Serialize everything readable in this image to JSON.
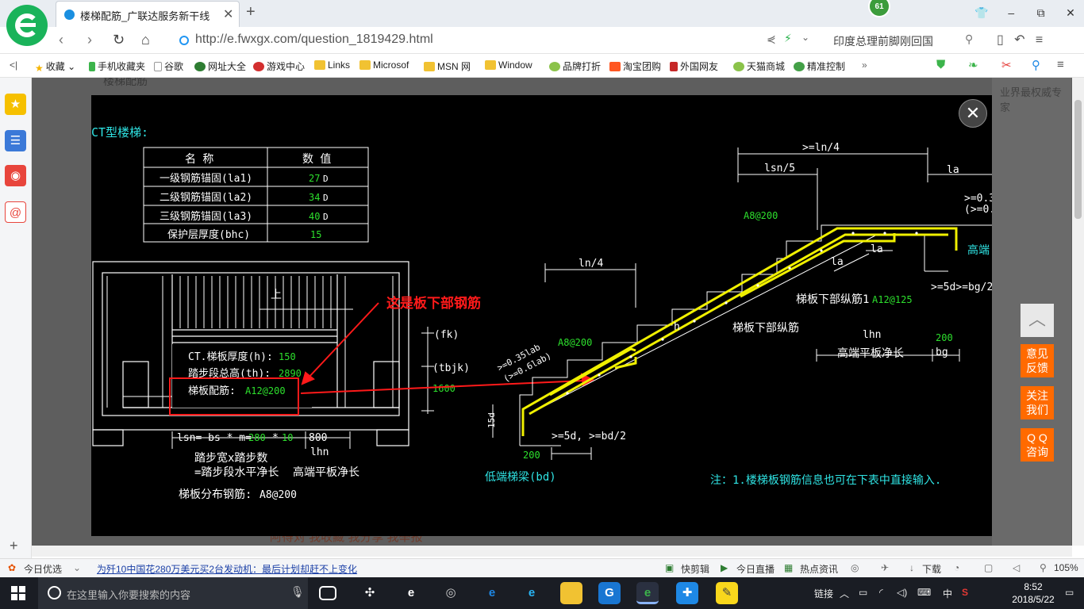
{
  "browser": {
    "tab_title": "楼梯配筋_广联达服务新干线",
    "notification_count": "61",
    "url": "http://e.fwxgx.com/question_1819429.html",
    "search_text": "印度总理前脚刚回国",
    "window_buttons": [
      "–",
      "⧉",
      "✕"
    ]
  },
  "bookmarks": [
    {
      "label": "收藏",
      "icon": "star-icon",
      "dropdown": true
    },
    {
      "label": "手机收藏夹",
      "icon": "phone-icon"
    },
    {
      "label": "谷歌",
      "icon": "page-icon"
    },
    {
      "label": "网址大全",
      "icon": "navigation-icon"
    },
    {
      "label": "游戏中心",
      "icon": "game-icon"
    },
    {
      "label": "Links",
      "icon": "folder-icon"
    },
    {
      "label": "Microsof",
      "icon": "folder-icon"
    },
    {
      "label": "MSN 网",
      "icon": "folder-icon"
    },
    {
      "label": "Window",
      "icon": "folder-icon"
    },
    {
      "label": "品牌打折",
      "icon": "leaf-icon"
    },
    {
      "label": "淘宝团购",
      "icon": "taobao-icon"
    },
    {
      "label": "外国网友",
      "icon": "bookmark-icon"
    },
    {
      "label": "天猫商城",
      "icon": "leaf-icon"
    },
    {
      "label": "精准控制",
      "icon": "chat-icon"
    }
  ],
  "page_behind": {
    "title": "楼梯配筋",
    "bottom_links": "阿得对        我收藏        我分享        我举报",
    "right_text": "业界最权威专家"
  },
  "drawing": {
    "heading": "CT型楼梯:",
    "table_header": [
      "名 称",
      "数 值"
    ],
    "table_rows": [
      {
        "name": "一级钢筋锚固(la1)",
        "value": "27",
        "unit": "D"
      },
      {
        "name": "二级钢筋锚固(la2)",
        "value": "34",
        "unit": "D"
      },
      {
        "name": "三级钢筋锚固(la3)",
        "value": "40",
        "unit": "D"
      },
      {
        "name": "保护层厚度(bhc)",
        "value": "15",
        "unit": ""
      }
    ],
    "plan_up": "上",
    "thickness_label": "CT.梯板厚度(h):",
    "thickness_value": "150",
    "height_label": "踏步段总高(th):",
    "height_value": "2890",
    "rebar_label": "梯板配筋:",
    "rebar_value": "A12@200",
    "fk": "(fk)",
    "tbjk": "(tbjk)",
    "tbjk_value": "1600",
    "lsn_formula": "lsn= bs * m=",
    "lsn_bs": "280",
    "lsn_mul": "*",
    "lsn_m": "10",
    "lhn_value": "800",
    "lhn_label": "lhn",
    "step_width_label": "踏步宽x踏步数",
    "horizontal_length_label": "=踏步段水平净长",
    "high_platform_label": "高端平板净长",
    "distribution_label": "梯板分布钢筋:",
    "distribution_value": "A8@200",
    "annotation": "这是板下部钢筋",
    "ln4": "ln/4",
    "ln4_top": ">=ln/4",
    "lsn5": "lsn/5",
    "la": "la",
    "a8_top": "A8@200",
    "a8_mid": "A8@200",
    "anchor_note": ">=0.35lab",
    "anchor_note2": "(>=0.6lab)",
    "h_label": "h",
    "lower_long_bar": "梯板下部纵筋",
    "lower_long_bar1": "梯板下部纵筋1",
    "lower_long_bar1_value": "A12@125",
    "lhn_right": "lhn",
    "bg_value": "200",
    "bg_label": "bg",
    "high_platform_label2": "高端平板净长",
    "high_beam_label": "高端",
    "right_03": ">=0.3",
    "right_02": "(>=0.",
    "five_d_bg": ">=5d>=bg/2",
    "five_d_bd": ">=5d, >=bd/2",
    "fifteen_d": "15d",
    "bd_value": "200",
    "low_beam_label": "低端梯梁(bd)",
    "note": "注：1.楼梯板钢筋信息也可在下表中直接输入."
  },
  "float_panel": {
    "feedback": "意见\n反馈",
    "follow": "关注\n我们",
    "qq": "Q Q\n咨询"
  },
  "statusbar": {
    "left_label": "今日优选",
    "news": "为歼10中国花280万美元买2台发动机：最后计划却赶不上变化",
    "quick_clip": "快剪辑",
    "live": "今日直播",
    "hot_news": "热点资讯",
    "download": "下载",
    "zoom": "105%"
  },
  "taskbar": {
    "search_placeholder": "在这里输入你要搜索的内容",
    "tray_link": "链接",
    "ime": "中",
    "time": "8:52",
    "date": "2018/5/22"
  }
}
